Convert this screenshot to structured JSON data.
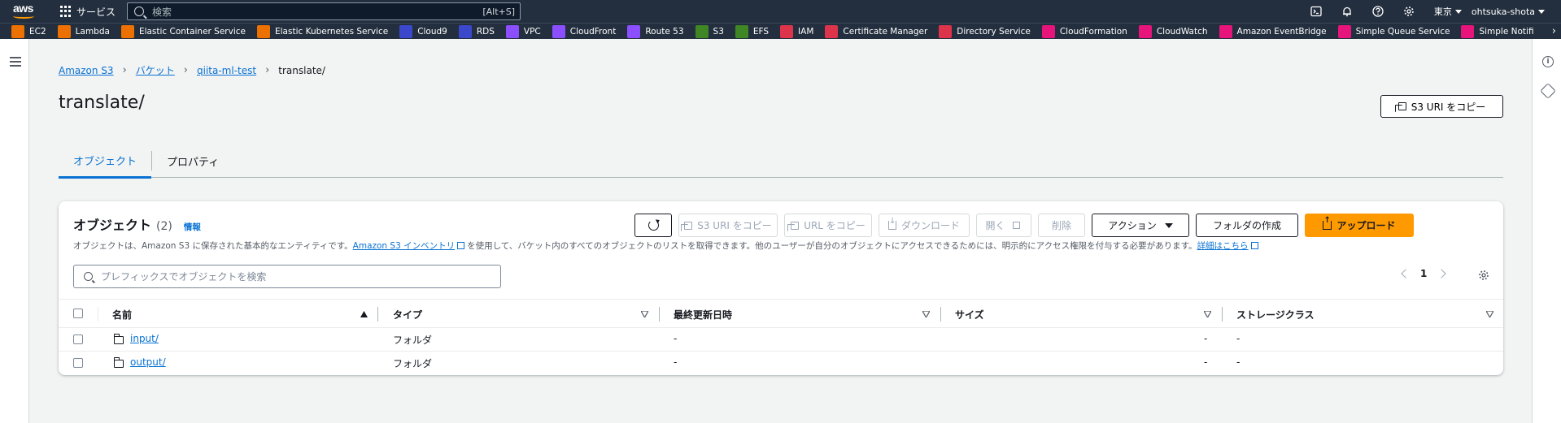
{
  "topnav": {
    "logo": "aws",
    "services_label": "サービス",
    "search_placeholder": "検索",
    "search_shortcut": "[Alt+S]",
    "region": "東京",
    "user": "ohtsuka-shota"
  },
  "favorites": [
    {
      "label": "EC2",
      "color": "#ed7100"
    },
    {
      "label": "Lambda",
      "color": "#ed7100"
    },
    {
      "label": "Elastic Container Service",
      "color": "#ed7100"
    },
    {
      "label": "Elastic Kubernetes Service",
      "color": "#ed7100"
    },
    {
      "label": "Cloud9",
      "color": "#3b48cc"
    },
    {
      "label": "RDS",
      "color": "#3b48cc"
    },
    {
      "label": "VPC",
      "color": "#8c4fff"
    },
    {
      "label": "CloudFront",
      "color": "#8c4fff"
    },
    {
      "label": "Route 53",
      "color": "#8c4fff"
    },
    {
      "label": "S3",
      "color": "#3f8624"
    },
    {
      "label": "EFS",
      "color": "#3f8624"
    },
    {
      "label": "IAM",
      "color": "#dd344c"
    },
    {
      "label": "Certificate Manager",
      "color": "#dd344c"
    },
    {
      "label": "Directory Service",
      "color": "#dd344c"
    },
    {
      "label": "CloudFormation",
      "color": "#e7157b"
    },
    {
      "label": "CloudWatch",
      "color": "#e7157b"
    },
    {
      "label": "Amazon EventBridge",
      "color": "#e7157b"
    },
    {
      "label": "Simple Queue Service",
      "color": "#e7157b"
    },
    {
      "label": "Simple Notifi",
      "color": "#e7157b"
    }
  ],
  "breadcrumb": {
    "items": [
      "Amazon S3",
      "バケット",
      "qiita-ml-test"
    ],
    "current": "translate/"
  },
  "page": {
    "title": "translate/",
    "copy_uri_label": "S3 URI をコピー"
  },
  "tabs": [
    {
      "label": "オブジェクト",
      "active": true
    },
    {
      "label": "プロパティ",
      "active": false
    }
  ],
  "panel": {
    "title": "オブジェクト",
    "count": "(2)",
    "info": "情報",
    "desc_pre": "オブジェクトは、Amazon S3 に保存された基本的なエンティティです。",
    "desc_link1": "Amazon S3 インベントリ",
    "desc_mid": "を使用して、バケット内のすべてのオブジェクトのリストを取得できます。他のユーザーが自分のオブジェクトにアクセスできるためには、明示的にアクセス権限を付与する必要があります。",
    "desc_link2": "詳細はこちら",
    "buttons": {
      "copy_s3_uri": "S3 URI をコピー",
      "copy_url": "URL をコピー",
      "download": "ダウンロード",
      "open": "開く",
      "delete": "削除",
      "actions": "アクション",
      "create_folder": "フォルダの作成",
      "upload": "アップロード"
    },
    "filter_placeholder": "プレフィックスでオブジェクトを検索",
    "page_number": "1"
  },
  "table": {
    "columns": [
      "名前",
      "タイプ",
      "最終更新日時",
      "サイズ",
      "ストレージクラス"
    ],
    "rows": [
      {
        "name": "input/",
        "type": "フォルダ",
        "modified": "-",
        "size": "-",
        "storage": "-"
      },
      {
        "name": "output/",
        "type": "フォルダ",
        "modified": "-",
        "size": "-",
        "storage": "-"
      }
    ]
  },
  "colors": {
    "nav_bg": "#232f3e",
    "link": "#0972d3",
    "primary": "#ff9900"
  }
}
